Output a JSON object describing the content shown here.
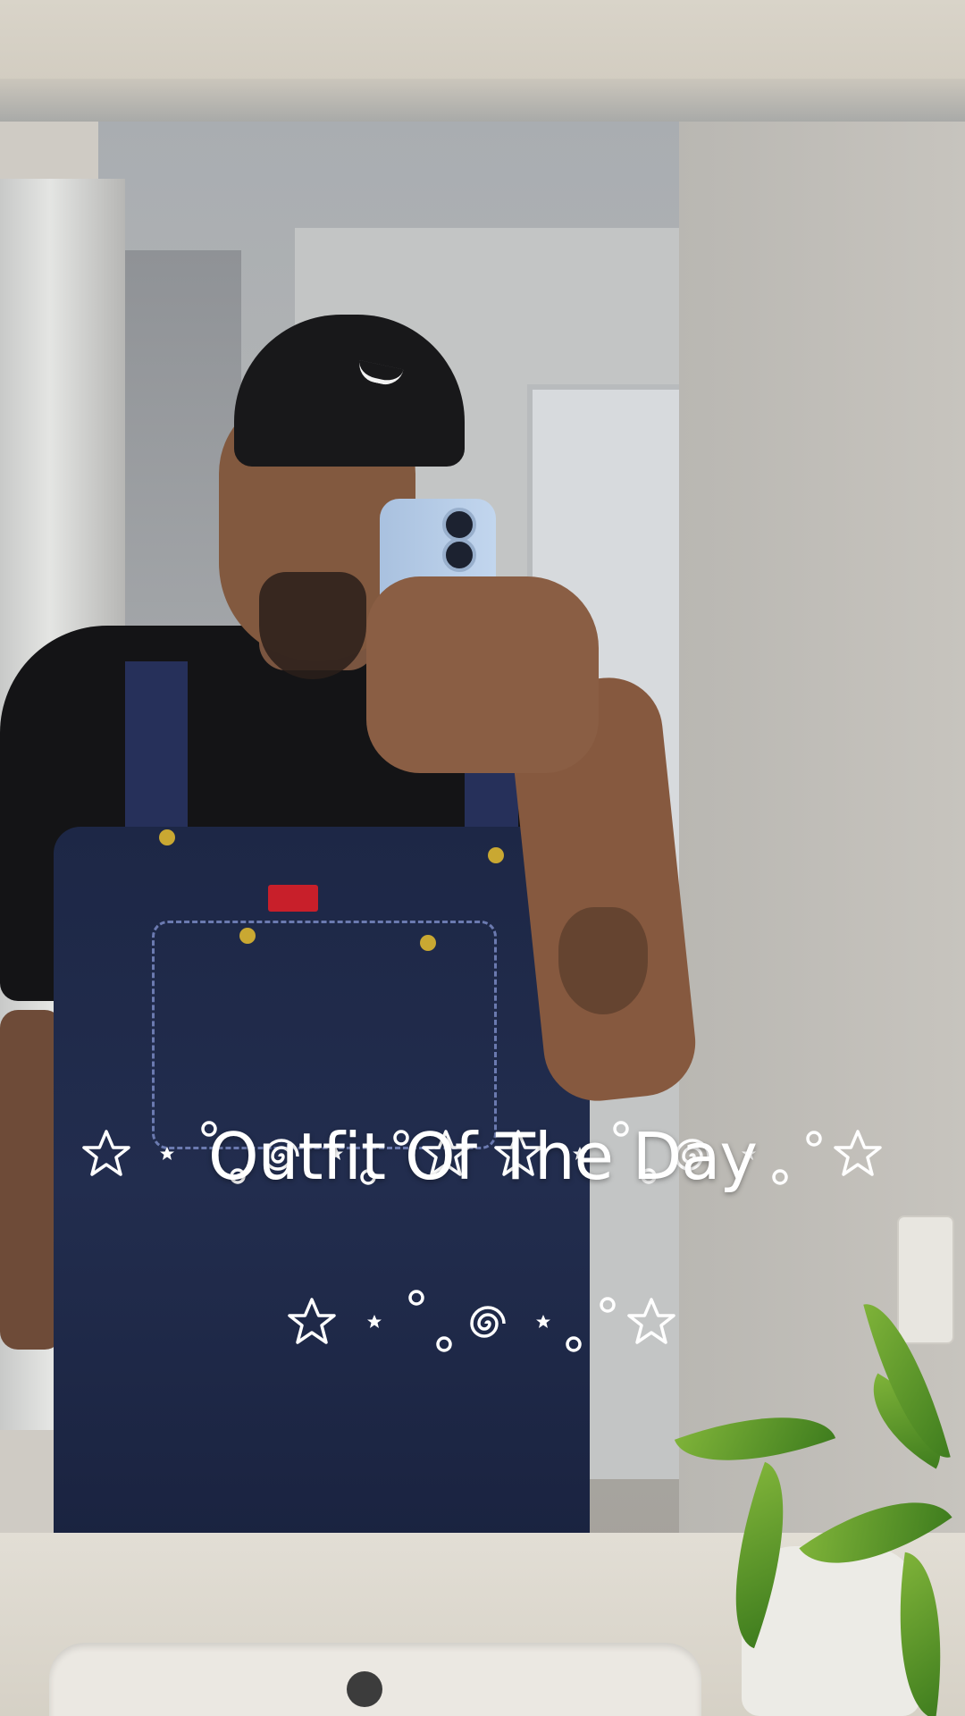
{
  "overlay": {
    "title": "Outfit Of The Day"
  },
  "photo": {
    "subject_icons": [
      "star-icon",
      "spiral-icon",
      "circle-icon"
    ]
  },
  "colors": {
    "text": "#ffffff",
    "denim": "#1d2746",
    "shirt": "#141416",
    "cap": "#18181a",
    "phone": "#b6cde8"
  }
}
